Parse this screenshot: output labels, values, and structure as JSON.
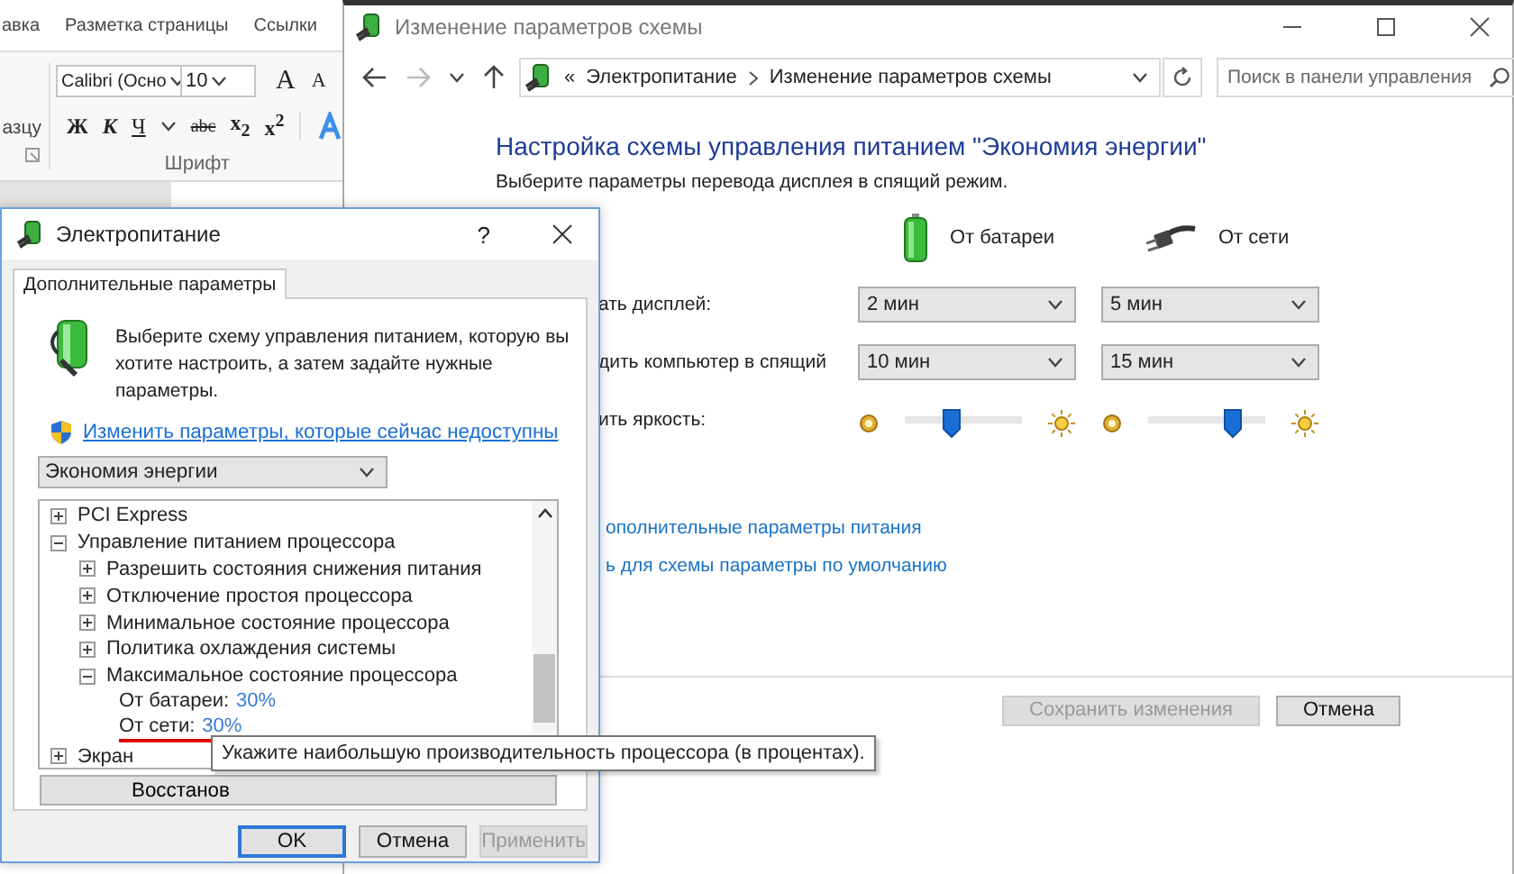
{
  "word": {
    "tabs": [
      "авка",
      "Разметка страницы",
      "Ссылки"
    ],
    "side_label": "азцу",
    "font_name": "Calibri (Осно",
    "font_size": "10",
    "grow_font": "A",
    "shrink_font": "A",
    "format_buttons": [
      {
        "label": "Ж",
        "kind": "bold"
      },
      {
        "label": "К",
        "kind": "italic"
      },
      {
        "label": "Ч",
        "kind": "underline"
      },
      {
        "label": "abc",
        "kind": "strike"
      },
      {
        "label": "x$_{2}$",
        "kind": "plain"
      },
      {
        "label": "x$^{2}$",
        "kind": "plain"
      }
    ],
    "group_label": "Шрифт"
  },
  "control_panel": {
    "title": "Изменение параметров схемы",
    "breadcrumb_prefix": "«",
    "breadcrumb": [
      "Электропитание",
      "Изменение параметров схемы"
    ],
    "search": {
      "placeholder": "Поиск в панели управления"
    },
    "heading": "Настройка схемы управления питанием \"Экономия энергии\"",
    "subtitle": "Выберите параметры перевода дисплея в спящий режим.",
    "columns": [
      {
        "label": "От батареи",
        "kind": "battery"
      },
      {
        "label": "От сети",
        "kind": "plug"
      }
    ],
    "rows": [
      {
        "label": "ать дисплей:",
        "kind": "select",
        "values": [
          "2 мин",
          "5 мин"
        ]
      },
      {
        "label": "дить компьютер в спящий",
        "kind": "select",
        "values": [
          "10 мин",
          "15 мин"
        ]
      },
      {
        "label": "ить яркость:",
        "kind": "slider",
        "sliders": [
          {
            "level": 0.4
          },
          {
            "level": 0.73
          }
        ]
      }
    ],
    "links": [
      "ополнительные параметры питания",
      "ь для схемы параметры по умолчанию"
    ],
    "buttons": [
      {
        "label": "Сохранить изменения",
        "disabled": true
      },
      {
        "label": "Отмена",
        "disabled": false
      }
    ]
  },
  "dialog": {
    "title": "Электропитание",
    "help": "?",
    "tabs": [
      {
        "label": "Дополнительные параметры",
        "selected": true
      }
    ],
    "intro": "Выберите схему управления питанием, которую вы хотите настроить, а затем задайте нужные параметры.",
    "link": "Изменить параметры, которые сейчас недоступны",
    "scheme": "Экономия энергии",
    "tree": [
      {
        "label": "PCI Express",
        "expanded": false
      },
      {
        "label": "Управление питанием процессора",
        "expanded": true,
        "children": [
          {
            "label": "Разрешить состояния снижения питания",
            "expanded": false
          },
          {
            "label": "Отключение простоя процессора",
            "expanded": false
          },
          {
            "label": "Минимальное состояние процессора",
            "expanded": false
          },
          {
            "label": "Политика охлаждения системы",
            "expanded": false
          },
          {
            "label": "Максимальное состояние процессора",
            "expanded": true,
            "children": [
              {
                "kind": "value",
                "label": "От батареи:",
                "value": "30%",
                "underlined": false
              },
              {
                "kind": "value",
                "label": "От сети:",
                "value": "30%",
                "underlined": true
              }
            ]
          }
        ]
      },
      {
        "label": "Экран",
        "expanded": false
      }
    ],
    "restore_button": "Восстанов",
    "buttons": [
      {
        "label": "OK",
        "default": true,
        "disabled": false
      },
      {
        "label": "Отмена",
        "default": false,
        "disabled": false
      },
      {
        "label": "Применить",
        "default": false,
        "disabled": true
      }
    ]
  },
  "tooltip": "Укажите наибольшую производительность процессора (в процентах)."
}
